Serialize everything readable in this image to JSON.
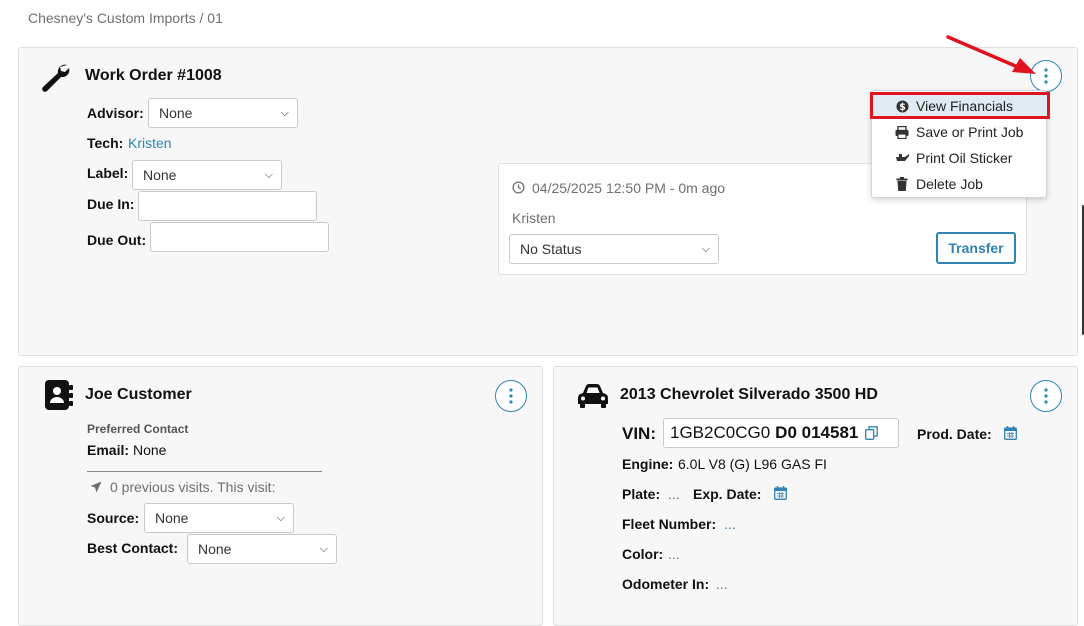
{
  "breadcrumb": "Chesney's Custom Imports / 01",
  "work_order": {
    "title": "Work Order #1008",
    "advisor_label": "Advisor:",
    "advisor_value": "None",
    "tech_label": "Tech:",
    "tech_value": "Kristen",
    "label_label": "Label:",
    "label_value": "None",
    "due_in_label": "Due In:",
    "due_in_value": "",
    "due_out_label": "Due Out:",
    "due_out_value": ""
  },
  "status_card": {
    "timestamp": "04/25/2025 12:50 PM - 0m ago",
    "user": "Kristen",
    "status_value": "No Status",
    "transfer_label": "Transfer"
  },
  "menu": {
    "items": [
      {
        "label": "View Financials",
        "icon": "dollar-circle-icon"
      },
      {
        "label": "Save or Print Job",
        "icon": "printer-icon"
      },
      {
        "label": "Print Oil Sticker",
        "icon": "oil-can-icon"
      },
      {
        "label": "Delete Job",
        "icon": "trash-icon"
      }
    ]
  },
  "customer": {
    "name": "Joe Customer",
    "preferred_contact_label": "Preferred Contact",
    "email_label": "Email:",
    "email_value": "None",
    "visits_text": "0 previous visits. This visit:",
    "source_label": "Source:",
    "source_value": "None",
    "best_contact_label": "Best Contact:",
    "best_contact_value": "None"
  },
  "vehicle": {
    "title": "2013 Chevrolet Silverado 3500 HD",
    "vin_label": "VIN:",
    "vin_part1": "1GB2C0CG0",
    "vin_part2": "D0 014581",
    "prod_date_label": "Prod. Date:",
    "engine_label": "Engine:",
    "engine_value": "6.0L V8 (G) L96 GAS FI",
    "plate_label": "Plate:",
    "plate_value": "...",
    "exp_date_label": "Exp. Date:",
    "fleet_label": "Fleet Number:",
    "fleet_value": "...",
    "color_label": "Color:",
    "color_value": "...",
    "odometer_label": "Odometer In:",
    "odometer_value": "..."
  },
  "colors": {
    "accent": "#2f83b5",
    "highlight_box": "#e0141e",
    "panel_bg": "#f7f7f7"
  }
}
